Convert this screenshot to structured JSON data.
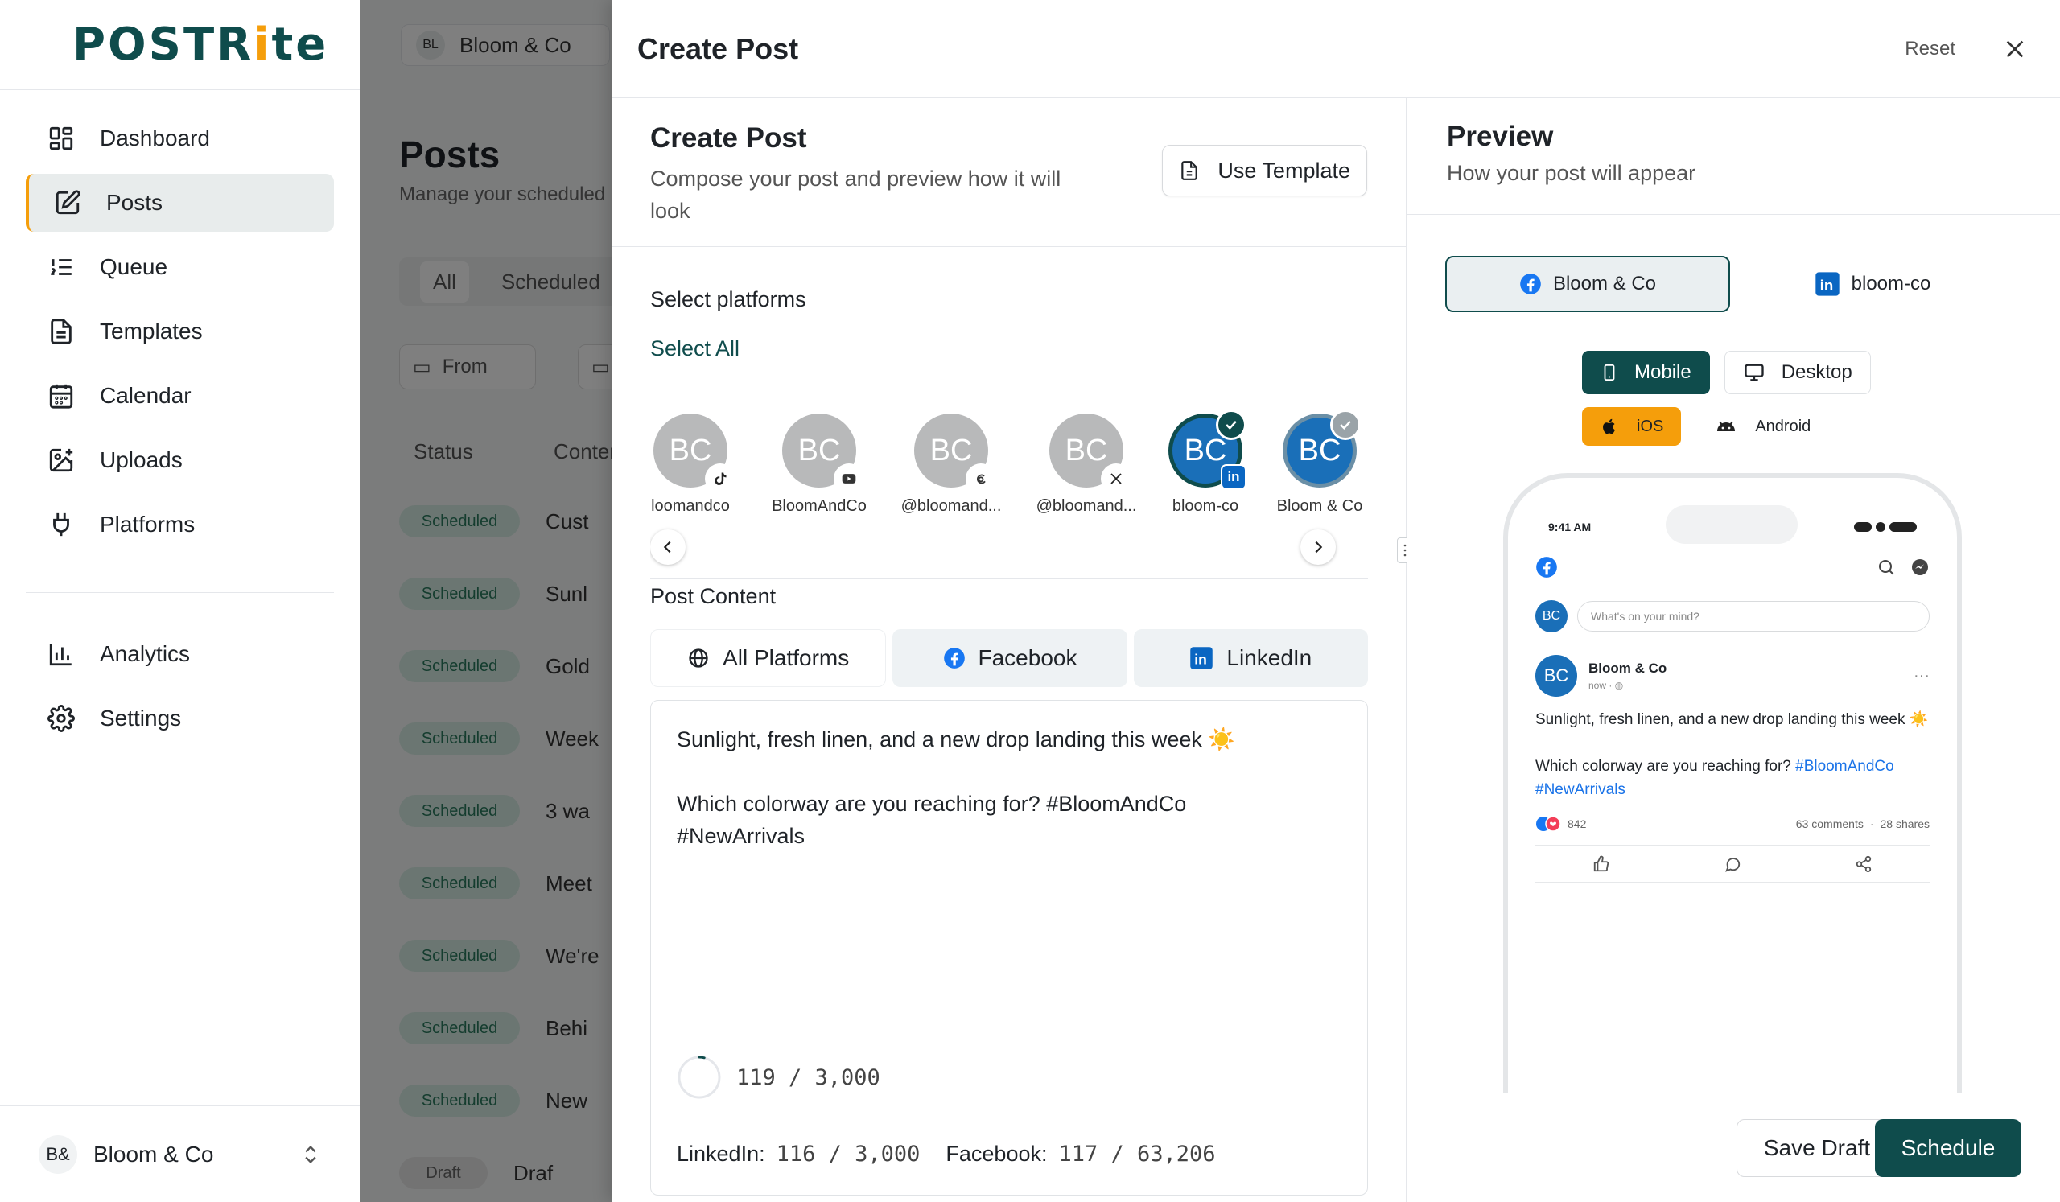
{
  "app": {
    "logo_main": "POSTR",
    "logo_accent": "i",
    "logo_end": "te"
  },
  "sidebar": {
    "items": [
      {
        "label": "Dashboard",
        "icon": "dashboard-icon"
      },
      {
        "label": "Posts",
        "icon": "edit-icon",
        "active": true
      },
      {
        "label": "Queue",
        "icon": "list-ordered-icon"
      },
      {
        "label": "Templates",
        "icon": "document-icon"
      },
      {
        "label": "Calendar",
        "icon": "calendar-icon"
      },
      {
        "label": "Uploads",
        "icon": "image-upload-icon"
      },
      {
        "label": "Platforms",
        "icon": "plug-icon"
      }
    ],
    "bottom_items": [
      {
        "label": "Analytics",
        "icon": "bar-chart-icon"
      },
      {
        "label": "Settings",
        "icon": "gear-icon"
      }
    ],
    "workspace": {
      "badge": "B&",
      "name": "Bloom & Co"
    }
  },
  "background_page": {
    "workspace_chip": "Bloom & Co",
    "workspace_initials": "BL",
    "title": "Posts",
    "subtitle": "Manage your scheduled",
    "tabs": [
      "All",
      "Scheduled"
    ],
    "filter_from": "From",
    "columns": [
      "Status",
      "Content"
    ],
    "rows": [
      {
        "status": "Scheduled",
        "content": "Cust"
      },
      {
        "status": "Scheduled",
        "content": "Sunl"
      },
      {
        "status": "Scheduled",
        "content": "Gold"
      },
      {
        "status": "Scheduled",
        "content": "Week"
      },
      {
        "status": "Scheduled",
        "content": "3 wa"
      },
      {
        "status": "Scheduled",
        "content": "Meet"
      },
      {
        "status": "Scheduled",
        "content": "We're"
      },
      {
        "status": "Scheduled",
        "content": "Behi"
      },
      {
        "status": "Scheduled",
        "content": "New"
      },
      {
        "status": "Draft",
        "content": "Draf"
      }
    ]
  },
  "modal": {
    "title": "Create Post",
    "reset_label": "Reset",
    "compose": {
      "title": "Create Post",
      "description": "Compose your post and preview how it will look",
      "use_template_label": "Use Template"
    },
    "select_platforms_label": "Select platforms",
    "select_all_label": "Select All",
    "accounts": [
      {
        "initials": "BC",
        "name": "loomandco",
        "platform": "tiktok",
        "selected": false
      },
      {
        "initials": "BC",
        "name": "BloomAndCo",
        "platform": "youtube",
        "selected": false
      },
      {
        "initials": "BC",
        "name": "@bloomand...",
        "platform": "threads",
        "selected": false
      },
      {
        "initials": "BC",
        "name": "@bloomand...",
        "platform": "x",
        "selected": false
      },
      {
        "initials": "BC",
        "name": "bloom-co",
        "platform": "linkedin",
        "selected": true
      },
      {
        "initials": "BC",
        "name": "Bloom & Co",
        "platform": "facebook",
        "selected": true
      }
    ],
    "post_content_label": "Post Content",
    "content_tabs": [
      {
        "label": "All Platforms",
        "icon": "globe-icon",
        "active": true
      },
      {
        "label": "Facebook",
        "icon": "facebook-icon"
      },
      {
        "label": "LinkedIn",
        "icon": "linkedin-icon"
      }
    ],
    "editor": {
      "text": "Sunlight, fresh linen, and a new drop landing this week ☀️\n\nWhich colorway are you reaching for? #BloomAndCo\n#NewArrivals",
      "char_count": "119 / 3,000",
      "char_progress": 0.04,
      "linkedin_label": "LinkedIn:",
      "linkedin_count": "116 / 3,000",
      "facebook_label": "Facebook:",
      "facebook_count": "117 / 63,206"
    },
    "preview": {
      "title": "Preview",
      "subtitle": "How your post will appear",
      "account_tabs": [
        {
          "label": "Bloom & Co",
          "icon": "facebook-icon",
          "active": true
        },
        {
          "label": "bloom-co",
          "icon": "linkedin-icon"
        }
      ],
      "device_tabs": [
        {
          "label": "Mobile",
          "icon": "smartphone-icon",
          "active": true
        },
        {
          "label": "Desktop",
          "icon": "monitor-icon"
        }
      ],
      "os_tabs": [
        {
          "label": "iOS",
          "icon": "apple-icon",
          "active": true
        },
        {
          "label": "Android",
          "icon": "android-icon"
        }
      ],
      "phone": {
        "time": "9:41 AM",
        "compose_initials": "BC",
        "compose_placeholder": "What's on your mind?",
        "author": "Bloom & Co",
        "author_initials": "BC",
        "post_time": "now · ",
        "post_text_1": "Sunlight, fresh linen, and a new drop landing this week ☀️",
        "post_text_2": "Which colorway are you reaching for? ",
        "hashtag_1": "#BloomAndCo",
        "hashtag_2": "#NewArrivals",
        "reactions": "842",
        "comments": "63 comments",
        "shares": "28 shares"
      }
    },
    "footer": {
      "save_draft_label": "Save Draft",
      "schedule_label": "Schedule"
    }
  },
  "colors": {
    "brand": "#0f4c4c",
    "accent": "#f59e0b",
    "facebook": "#1877f2",
    "linkedin": "#0a66c2"
  }
}
